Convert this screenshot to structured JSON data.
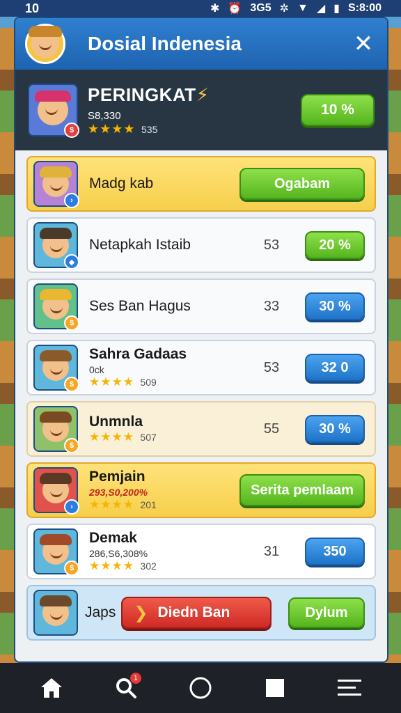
{
  "status_bar": {
    "time": "10",
    "clock": "S:8:00",
    "icons": [
      "bluetooth-icon",
      "alarm-icon",
      "data-icon",
      "vibrate-icon",
      "wifi-icon",
      "signal-icon",
      "battery-icon"
    ],
    "data_label": "3G5"
  },
  "dialog": {
    "title": "Dosial Indenesia",
    "close_label": "✕"
  },
  "rank_banner": {
    "title": "PERINGKAT",
    "subtitle": "S8,330",
    "stars": "★★★★",
    "stars_count": "535",
    "button_label": "10 %"
  },
  "rows": [
    {
      "name": "Madg kab",
      "button": "Ogabam"
    },
    {
      "name": "Netapkah Istaib",
      "score": "53",
      "button": "20 %"
    },
    {
      "name": "Ses Ban Hagus",
      "score": "33",
      "button": "30 %"
    },
    {
      "name": "Sahra Gadaas",
      "sub": "0ck",
      "stars": "★★★★",
      "stars_count": "509",
      "score": "53",
      "button": "32 0"
    },
    {
      "name": "Unmnla",
      "stars": "★★★★",
      "stars_count": "507",
      "score": "55",
      "button": "30 %"
    },
    {
      "name": "Pemjain",
      "sub": "293,S0,200%",
      "stars": "★★★★",
      "stars_count": "201",
      "button": "Serita pemlaam"
    },
    {
      "name": "Demak",
      "sub": "286,S6,308%",
      "stars": "★★★★",
      "stars_count": "302",
      "score": "31",
      "button": "350"
    },
    {
      "name": "Japs",
      "red_button": "Diedn Ban",
      "button": "Dylum"
    }
  ],
  "colors": {
    "header": "#1f63b0",
    "banner": "#283644",
    "gold_row": "#f6cf4b",
    "green_button": "#55b51e",
    "blue_button": "#1e73c8",
    "red_button": "#cf2a24"
  },
  "bottom_nav": {
    "items": [
      "home-icon",
      "search-icon",
      "circle-icon",
      "square-icon",
      "menu-icon"
    ],
    "search_badge": "1"
  }
}
